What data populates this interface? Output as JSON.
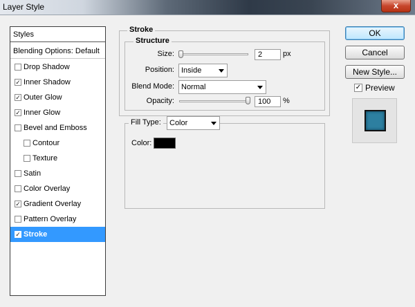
{
  "window": {
    "title": "Layer Style",
    "close_glyph": "x"
  },
  "styles_list": {
    "header": "Styles",
    "blending": "Blending Options: Default",
    "items": [
      {
        "label": "Drop Shadow",
        "checked": false
      },
      {
        "label": "Inner Shadow",
        "checked": true
      },
      {
        "label": "Outer Glow",
        "checked": true
      },
      {
        "label": "Inner Glow",
        "checked": true
      },
      {
        "label": "Bevel and Emboss",
        "checked": false
      },
      {
        "label": "Contour",
        "checked": false
      },
      {
        "label": "Texture",
        "checked": false
      },
      {
        "label": "Satin",
        "checked": false
      },
      {
        "label": "Color Overlay",
        "checked": false
      },
      {
        "label": "Gradient Overlay",
        "checked": true
      },
      {
        "label": "Pattern Overlay",
        "checked": false
      },
      {
        "label": "Stroke",
        "checked": true
      }
    ],
    "check_glyph": "✓"
  },
  "stroke": {
    "title": "Stroke",
    "structure": {
      "title": "Structure",
      "size_label": "Size:",
      "size_value": "2",
      "size_unit": "px",
      "position_label": "Position:",
      "position_value": "Inside",
      "blend_label": "Blend Mode:",
      "blend_value": "Normal",
      "opacity_label": "Opacity:",
      "opacity_value": "100",
      "opacity_unit": "%"
    },
    "fill": {
      "type_label": "Fill Type:",
      "type_value": "Color",
      "color_label": "Color:",
      "color_value": "#000000"
    }
  },
  "buttons": {
    "ok": "OK",
    "cancel": "Cancel",
    "new_style": "New Style..."
  },
  "preview": {
    "label": "Preview",
    "checked": true,
    "swatch_color": "#2d7fa0"
  }
}
